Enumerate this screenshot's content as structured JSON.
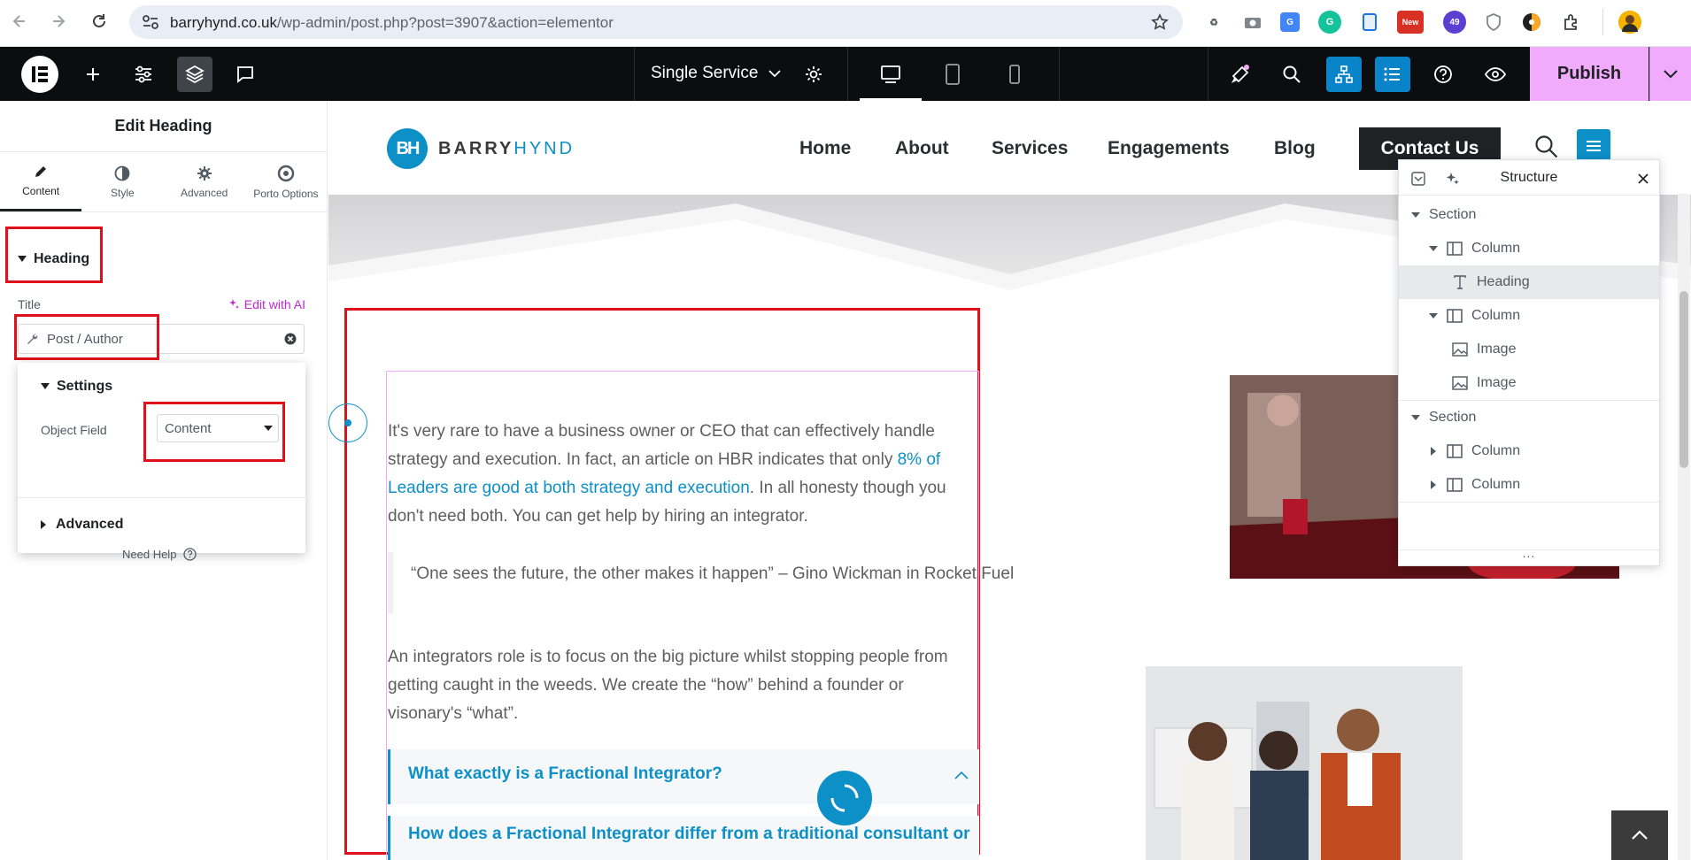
{
  "browser": {
    "url_host": "barryhynd.co.uk",
    "url_path": "/wp-admin/post.php?post=3907&action=elementor",
    "extension_badges": {
      "new": "New",
      "count": "49"
    }
  },
  "topbar": {
    "template_name": "Single Service",
    "publish_label": "Publish"
  },
  "panel": {
    "title": "Edit Heading",
    "tabs": [
      {
        "label": "Content"
      },
      {
        "label": "Style"
      },
      {
        "label": "Advanced"
      },
      {
        "label": "Porto Options"
      }
    ],
    "section_heading": "Heading",
    "title_label": "Title",
    "edit_ai": "Edit with AI",
    "dynamic_tag": "Post / Author",
    "settings": {
      "heading": "Settings",
      "object_field_label": "Object Field",
      "object_field_value": "Content",
      "advanced_label": "Advanced"
    },
    "need_help": "Need Help"
  },
  "site": {
    "logo_text_dark": "BARRY",
    "logo_text_light": "HYND",
    "logo_mark": "BH",
    "nav": [
      "Home",
      "About",
      "Services",
      "Engagements",
      "Blog"
    ],
    "contact_label": "Contact Us"
  },
  "content": {
    "p1_a": "It's very rare to have a business owner or CEO that can effectively handle strategy and execution. In fact, an article on HBR indicates that only ",
    "p1_link": "8% of Leaders are good at both strategy and execution",
    "p1_b": ". In all honesty though you don't need both. You can get help by hiring an integrator.",
    "quote": "“One sees the future, the other makes it happen” – Gino Wickman in Rocket Fuel",
    "p2": "An integrators role is to focus on the big picture whilst stopping people from getting caught in the weeds. We create the “how” behind a founder or visonary's “what”.",
    "faq1": "What exactly is a Fractional Integrator?",
    "faq2": "How does a Fractional Integrator differ from a traditional consultant or"
  },
  "structure": {
    "title": "Structure",
    "rows": [
      {
        "label": "Section"
      },
      {
        "label": "Column"
      },
      {
        "label": "Heading"
      },
      {
        "label": "Column"
      },
      {
        "label": "Image"
      },
      {
        "label": "Image"
      },
      {
        "label": "Section"
      },
      {
        "label": "Column"
      },
      {
        "label": "Column"
      }
    ],
    "more": "..."
  },
  "colors": {
    "accent": "#0d8fc7",
    "publish": "#f0abfc",
    "highlight_red": "#e0101a",
    "elementor_dark": "#0c0d0e"
  }
}
